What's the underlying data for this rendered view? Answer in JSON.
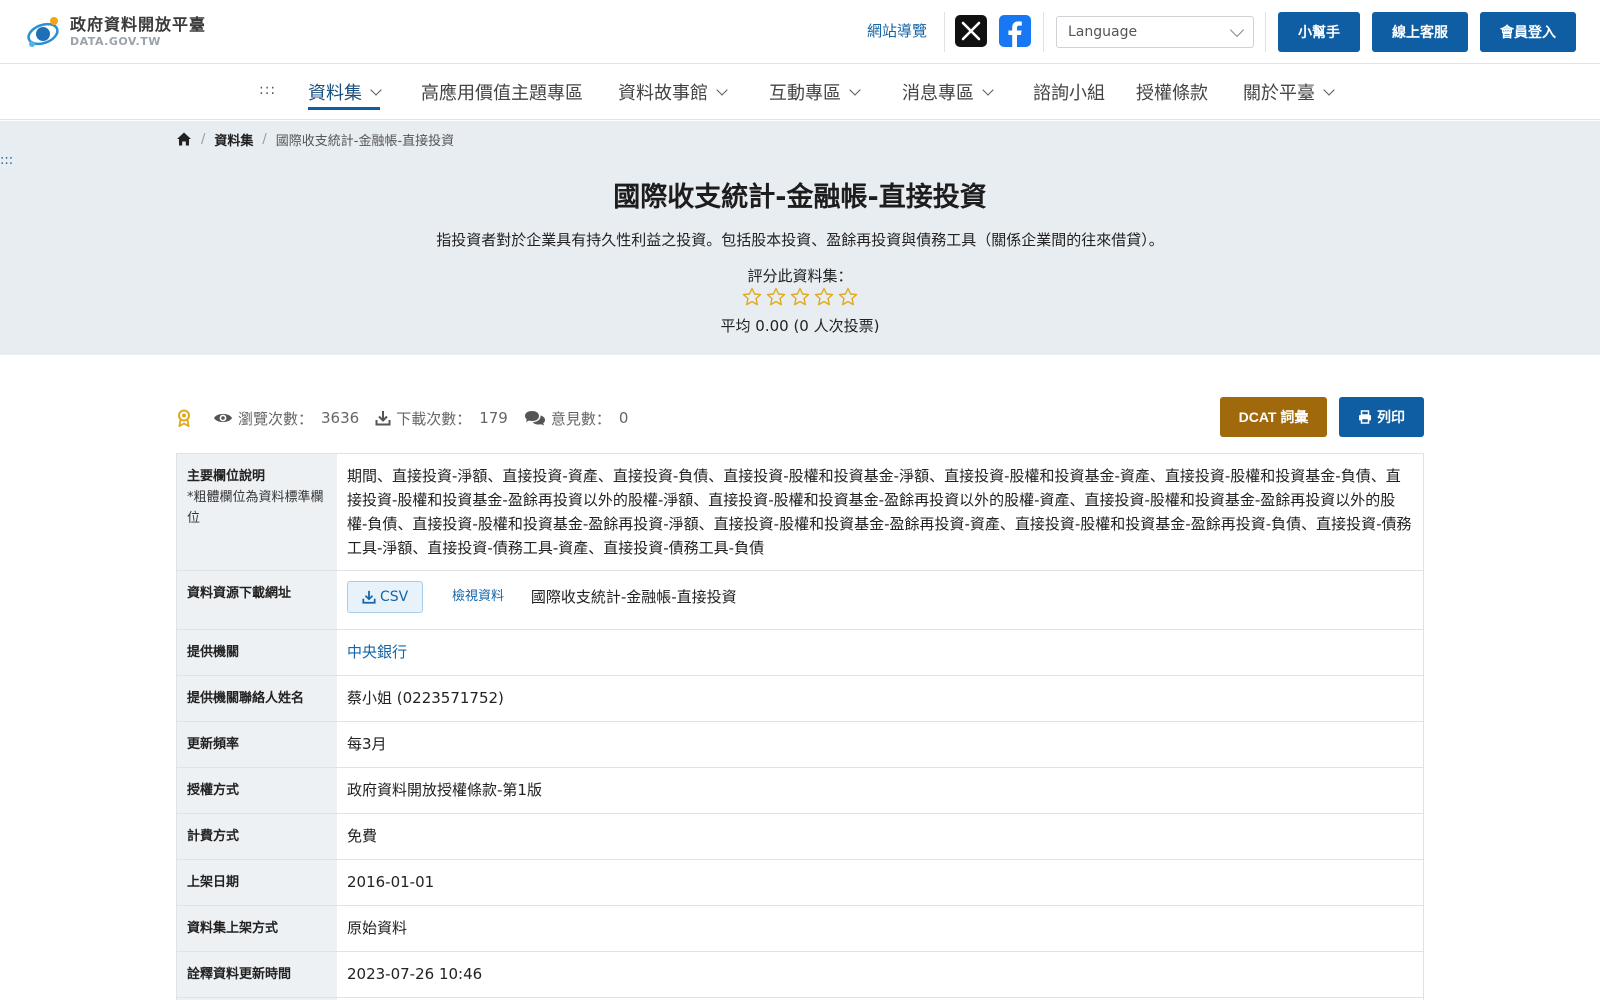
{
  "header": {
    "logo_title": "政府資料開放平臺",
    "logo_sub": "DATA.GOV.TW",
    "sitemap_label": "網站導覽",
    "language_placeholder": "Language",
    "helper_label": "小幫手",
    "support_label": "線上客服",
    "login_label": "會員登入"
  },
  "nav": {
    "dots": ":::",
    "items": [
      {
        "label": "資料集"
      },
      {
        "label": "高應用價值主題專區"
      },
      {
        "label": "資料故事館"
      },
      {
        "label": "互動專區"
      },
      {
        "label": "消息專區"
      },
      {
        "label": "諮詢小組"
      },
      {
        "label": "授權條款"
      },
      {
        "label": "關於平臺"
      }
    ]
  },
  "breadcrumb": {
    "items": [
      "資料集",
      "國際收支統計-金融帳-直接投資"
    ]
  },
  "skip_dots": ":::",
  "dataset": {
    "title": "國際收支統計-金融帳-直接投資",
    "description": "指投資者對於企業具有持久性利益之投資。包括股本投資、盈餘再投資與債務工具（關係企業間的往來借貸）。",
    "rating_label": "評分此資料集：",
    "rating_value": 0,
    "rating_max": 5,
    "average_text": "平均 0.00 (0 人次投票)"
  },
  "stats": {
    "views_label": "瀏覽次數：",
    "views": "3636",
    "downloads_label": "下載次數：",
    "downloads": "179",
    "comments_label": "意見數：",
    "comments": "0"
  },
  "actions": {
    "dcat_label": "DCAT 詞彙",
    "print_label": "列印"
  },
  "table": {
    "fields_header": "主要欄位說明",
    "fields_note": "*粗體欄位為資料標準欄位",
    "fields_value": "期間、直接投資-淨額、直接投資-資產、直接投資-負債、直接投資-股權和投資基金-淨額、直接投資-股權和投資基金-資產、直接投資-股權和投資基金-負債、直接投資-股權和投資基金-盈餘再投資以外的股權-淨額、直接投資-股權和投資基金-盈餘再投資以外的股權-資產、直接投資-股權和投資基金-盈餘再投資以外的股權-負債、直接投資-股權和投資基金-盈餘再投資-淨額、直接投資-股權和投資基金-盈餘再投資-資產、直接投資-股權和投資基金-盈餘再投資-負債、直接投資-債務工具-淨額、直接投資-債務工具-資產、直接投資-債務工具-負債",
    "download_header": "資料資源下載網址",
    "csv_label": "CSV",
    "view_label": "檢視資料",
    "resource_name": "國際收支統計-金融帳-直接投資",
    "rows": [
      {
        "header": "提供機關",
        "value": "中央銀行"
      },
      {
        "header": "提供機關聯絡人姓名",
        "value": "蔡小姐 (0223571752)"
      },
      {
        "header": "更新頻率",
        "value": "每3月"
      },
      {
        "header": "授權方式",
        "value": "政府資料開放授權條款-第1版"
      },
      {
        "header": "計費方式",
        "value": "免費"
      },
      {
        "header": "上架日期",
        "value": "2016-01-01"
      },
      {
        "header": "資料集上架方式",
        "value": "原始資料"
      },
      {
        "header": "詮釋資料更新時間",
        "value": "2023-07-26 10:46"
      }
    ]
  },
  "colors": {
    "primary_blue": "#0f5da3",
    "dcat_brown": "#a0690b",
    "hero_bg": "#e8edf2",
    "star_gold": "#e0a91d"
  }
}
